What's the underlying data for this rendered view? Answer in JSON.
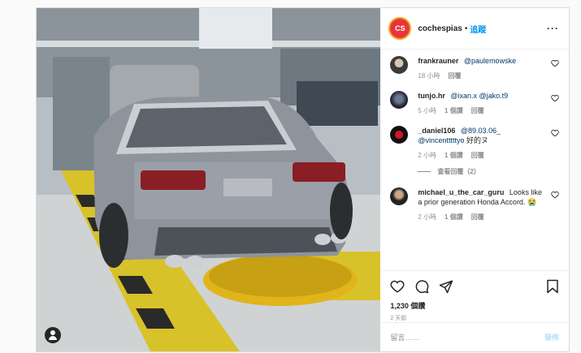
{
  "header": {
    "username": "cochespias",
    "separator": "•",
    "follow": "追蹤",
    "more": "···",
    "avatar_text": "CS"
  },
  "comments": [
    {
      "user": "frankrauner",
      "mention": "@paulemowske",
      "text": "",
      "time": "18 小時",
      "likes": "",
      "reply": "回覆",
      "avatar": "a1"
    },
    {
      "user": "tunjo.hr",
      "mention": "@ixan.x @jako.t9",
      "text": "",
      "time": "5 小時",
      "likes": "1 個讚",
      "reply": "回覆",
      "avatar": "a2"
    },
    {
      "user": "_daniel106",
      "mention": "@89.03.06_ @vincentttttyo",
      "text": "好的ヌ",
      "time": "2 小時",
      "likes": "1 個讚",
      "reply": "回覆",
      "avatar": "a3"
    },
    {
      "user": "michael_u_the_car_guru",
      "mention": "",
      "text": "Looks like a prior generation Honda Accord. 😭",
      "time": "2 小時",
      "likes": "1 個讚",
      "reply": "回覆",
      "avatar": "a4"
    }
  ],
  "view_replies": "查看回覆（2）",
  "likes_count": "1,230 個讚",
  "post_time": "2 天前",
  "add_comment_placeholder": "留言……",
  "post_button": "發佈",
  "icons": [
    "heart-icon",
    "comment-icon",
    "share-icon",
    "bookmark-icon",
    "tag-user-icon"
  ],
  "colors": {
    "follow_blue": "#0095f6",
    "mention": "#00376b",
    "meta_gray": "#8e8e8e"
  }
}
